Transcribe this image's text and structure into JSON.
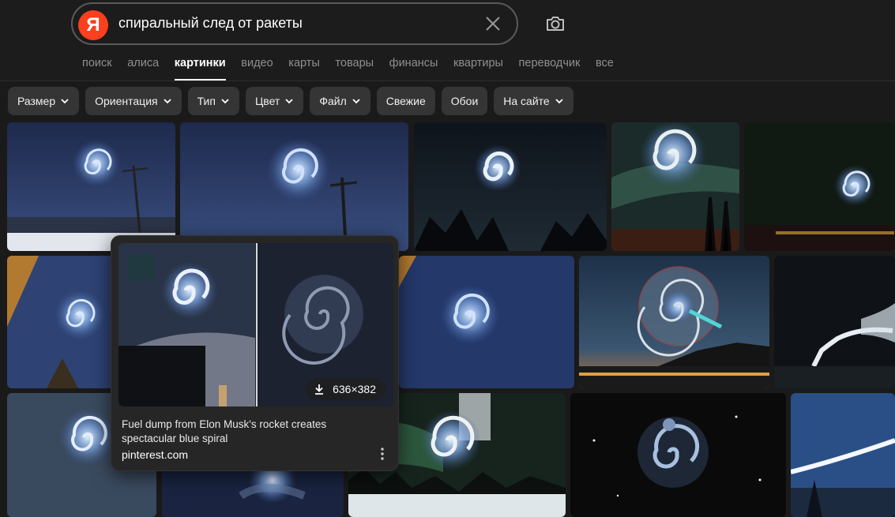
{
  "search": {
    "logo_letter": "Я",
    "query": "спиральный след от ракеты"
  },
  "tabs": [
    {
      "label": "поиск"
    },
    {
      "label": "алиса"
    },
    {
      "label": "картинки",
      "active": true
    },
    {
      "label": "видео"
    },
    {
      "label": "карты"
    },
    {
      "label": "товары"
    },
    {
      "label": "финансы"
    },
    {
      "label": "квартиры"
    },
    {
      "label": "переводчик"
    },
    {
      "label": "все"
    }
  ],
  "filters": [
    {
      "label": "Размер",
      "dropdown": true
    },
    {
      "label": "Ориентация",
      "dropdown": true
    },
    {
      "label": "Тип",
      "dropdown": true
    },
    {
      "label": "Цвет",
      "dropdown": true
    },
    {
      "label": "Файл",
      "dropdown": true
    },
    {
      "label": "Свежие",
      "dropdown": false
    },
    {
      "label": "Обои",
      "dropdown": false
    },
    {
      "label": "На сайте",
      "dropdown": true
    }
  ],
  "preview": {
    "size_label": "636×382",
    "title": "Fuel dump from Elon Musk's rocket creates spectacular blue spiral",
    "source": "pinterest.com"
  },
  "icons": {
    "clear": "close-icon",
    "camera": "camera-search-icon",
    "download": "download-icon",
    "more": "more-vertical-icon",
    "chevron": "chevron-down-icon"
  },
  "colors": {
    "brand": "#fc3f1d",
    "background": "#1a1a1a",
    "chip": "#353535"
  }
}
